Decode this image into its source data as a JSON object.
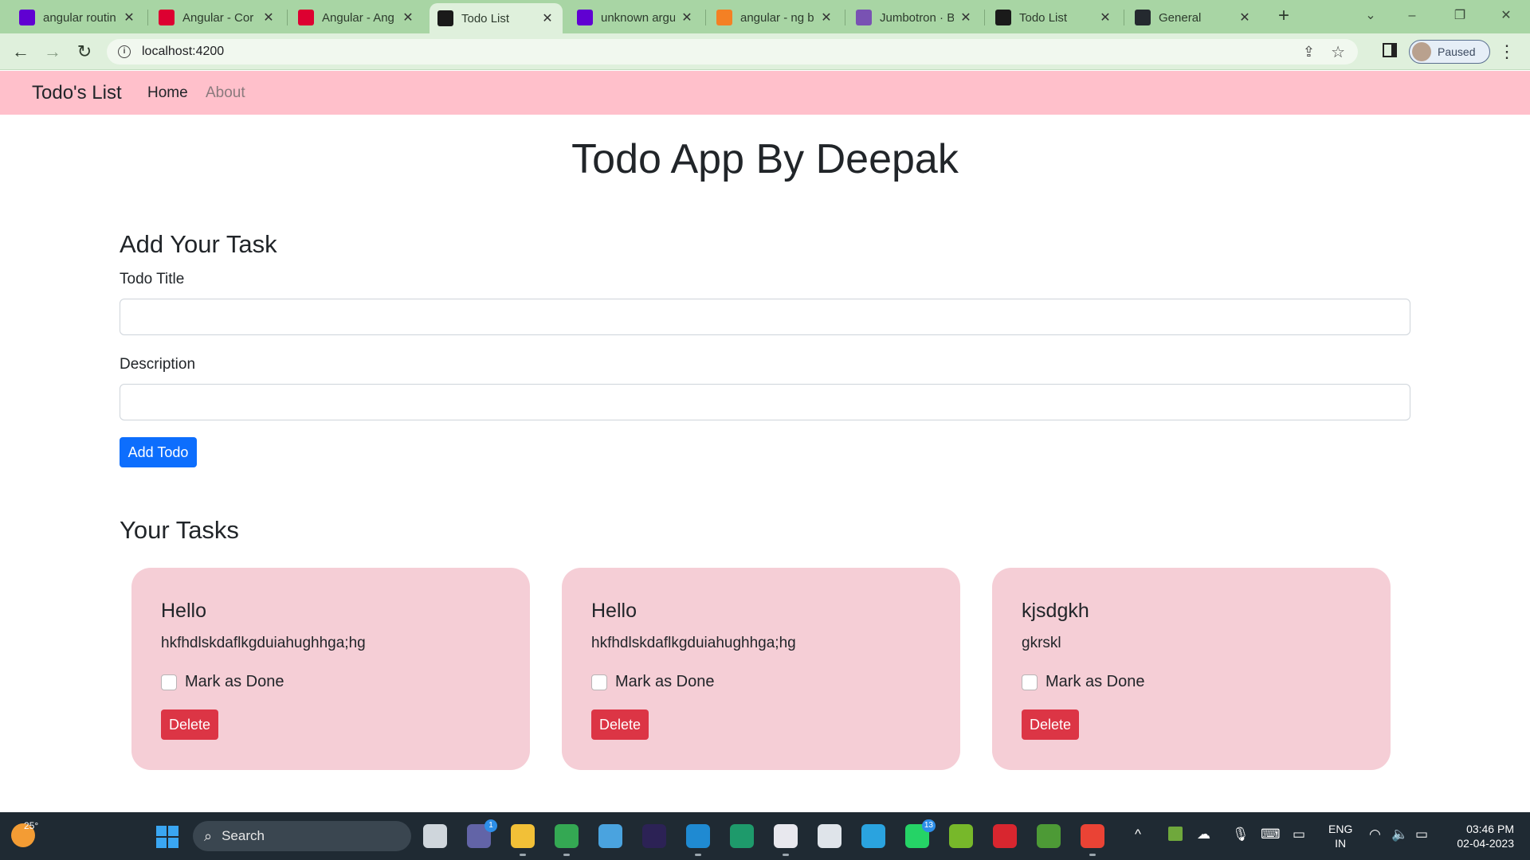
{
  "browser": {
    "tabs": [
      {
        "title": "angular routin",
        "icon": "yahoo-favicon",
        "color": "#6001d2"
      },
      {
        "title": "Angular - Cor",
        "icon": "angular-favicon",
        "color": "#dd0031"
      },
      {
        "title": "Angular - Ang",
        "icon": "angular-favicon",
        "color": "#dd0031"
      },
      {
        "title": "Todo List",
        "icon": "angular-favicon",
        "color": "#1a1a1a",
        "active": true
      },
      {
        "title": "unknown argu",
        "icon": "yahoo-favicon",
        "color": "#6001d2"
      },
      {
        "title": "angular - ng b",
        "icon": "stackoverflow-favicon",
        "color": "#f48024"
      },
      {
        "title": "Jumbotron · B",
        "icon": "bootstrap-favicon",
        "color": "#7952b3"
      },
      {
        "title": "Todo List",
        "icon": "angular-favicon",
        "color": "#1a1a1a"
      },
      {
        "title": "General",
        "icon": "github-favicon",
        "color": "#24292f"
      }
    ],
    "url": "localhost:4200",
    "profile_status": "Paused"
  },
  "navbar": {
    "brand": "Todo's List",
    "links": [
      "Home",
      "About"
    ],
    "background": "#ffc0cb"
  },
  "page": {
    "heading": "Todo App By Deepak",
    "add_section_title": "Add Your Task",
    "title_label": "Todo Title",
    "title_value": "",
    "description_label": "Description",
    "description_value": "",
    "add_button": "Add Todo",
    "tasks_section_title": "Your Tasks"
  },
  "tasks": [
    {
      "title": "Hello",
      "description": "hkfhdlskdaflkgduiahughhga;hg",
      "done_label": "Mark as Done",
      "done": false,
      "delete_label": "Delete"
    },
    {
      "title": "Hello",
      "description": "hkfhdlskdaflkgduiahughhga;hg",
      "done_label": "Mark as Done",
      "done": false,
      "delete_label": "Delete"
    },
    {
      "title": "kjsdgkh",
      "description": "gkrskl",
      "done_label": "Mark as Done",
      "done": false,
      "delete_label": "Delete"
    }
  ],
  "taskbar": {
    "weather_temp": "25°",
    "search_placeholder": "Search",
    "apps": [
      {
        "name": "task-view",
        "color": "#cfd6dc"
      },
      {
        "name": "teams-chat",
        "color": "#6264a7",
        "badge": "1"
      },
      {
        "name": "file-explorer",
        "color": "#f2c037",
        "running": true
      },
      {
        "name": "chrome",
        "color": "#34a853",
        "running": true
      },
      {
        "name": "notepad",
        "color": "#4aa3df"
      },
      {
        "name": "eclipse",
        "color": "#2c2255"
      },
      {
        "name": "vscode",
        "color": "#1f8ad2",
        "running": true
      },
      {
        "name": "app-tool",
        "color": "#1e9a6b"
      },
      {
        "name": "snipping-tool",
        "color": "#e8e8ee",
        "running": true
      },
      {
        "name": "document-editor",
        "color": "#dfe4ea"
      },
      {
        "name": "telegram",
        "color": "#2aa3df"
      },
      {
        "name": "whatsapp",
        "color": "#25d366",
        "badge": "13"
      },
      {
        "name": "utorrent",
        "color": "#77b82a"
      },
      {
        "name": "security-app",
        "color": "#d8262f"
      },
      {
        "name": "vim",
        "color": "#4d9a36"
      },
      {
        "name": "chrome-profile",
        "color": "#ea4335",
        "running": true
      }
    ],
    "language": [
      "ENG",
      "IN"
    ],
    "time": "03:46 PM",
    "date": "02-04-2023"
  }
}
